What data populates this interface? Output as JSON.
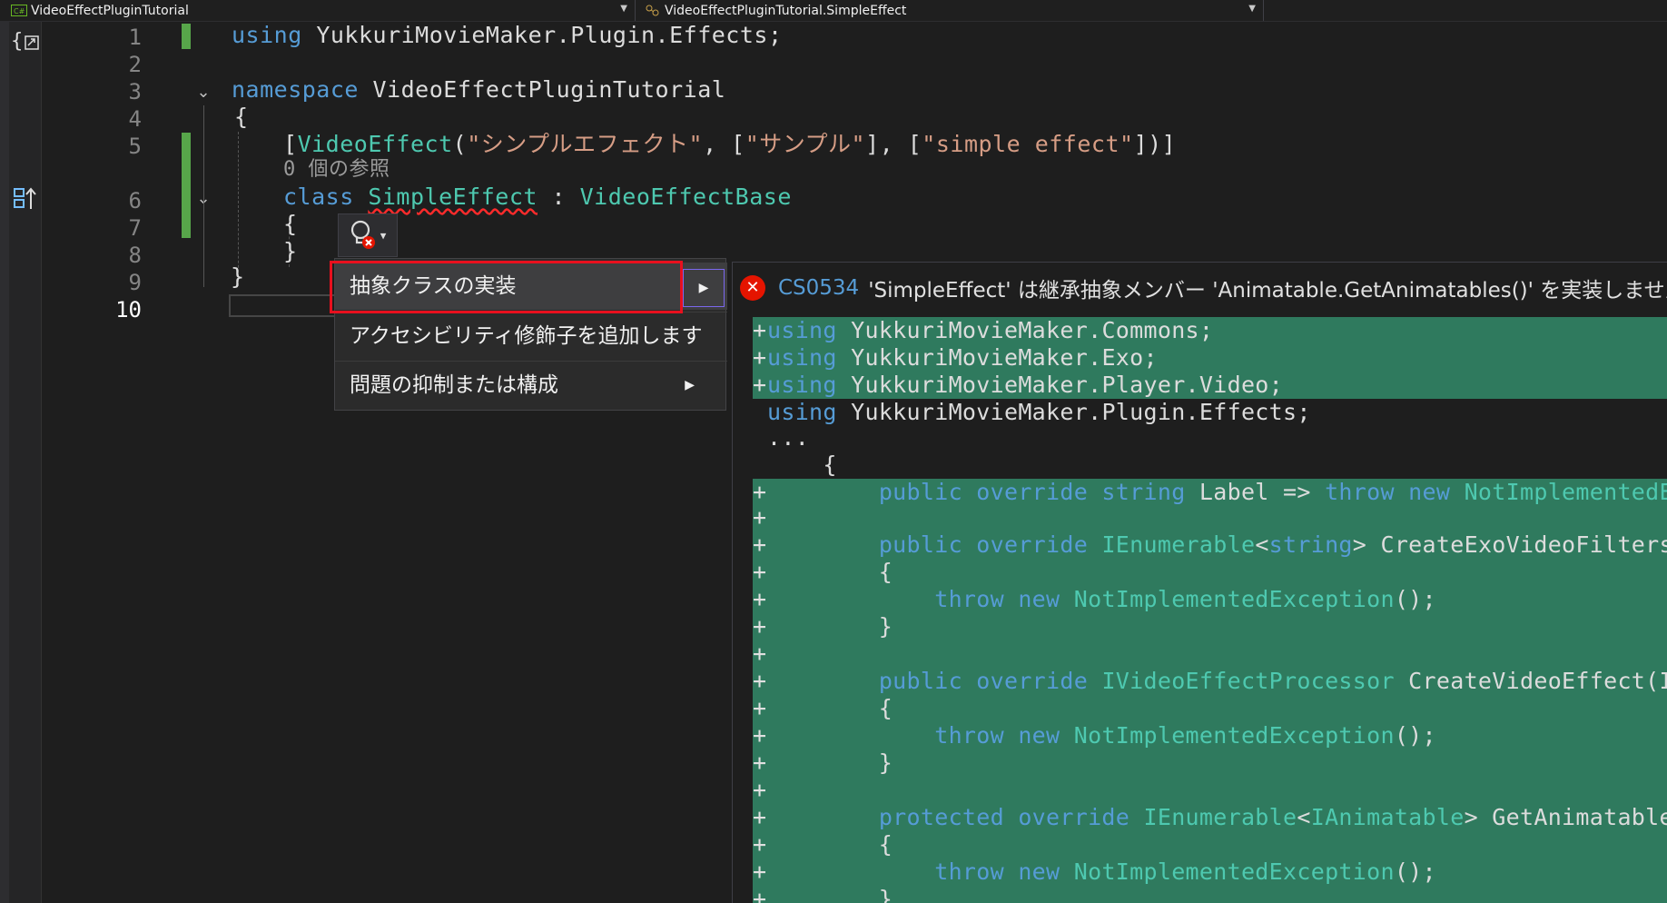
{
  "nav": {
    "project": "VideoEffectPluginTutorial",
    "member": "VideoEffectPluginTutorial.SimpleEffect"
  },
  "editor": {
    "line_numbers": [
      "1",
      "2",
      "3",
      "4",
      "5",
      "6",
      "7",
      "8",
      "9",
      "10"
    ],
    "line1": {
      "kw": "using",
      "rest": " YukkuriMovieMaker.Plugin.Effects;"
    },
    "line3": {
      "kw": "namespace",
      "rest": " VideoEffectPluginTutorial"
    },
    "line4": "{",
    "line5": {
      "open": "[",
      "attr": "VideoEffect",
      "p1": "(",
      "s1": "\"シンプルエフェクト\"",
      "p2": ", [",
      "s2": "\"サンプル\"",
      "p3": "], [",
      "s3": "\"simple effect\"",
      "p4": "])]"
    },
    "codelens": "0 個の参照",
    "line6": {
      "kw": "class",
      "name": "SimpleEffect",
      "colon": " : ",
      "base": "VideoEffectBase"
    },
    "line7": "{",
    "line8": "}",
    "line9": "}"
  },
  "quick_actions": {
    "items": [
      {
        "label": "抽象クラスの実装",
        "has_submenu": true
      },
      {
        "label": "アクセシビリティ修飾子を追加します",
        "has_submenu": false
      },
      {
        "label": "問題の抑制または構成",
        "has_submenu": true
      }
    ]
  },
  "preview": {
    "error_code": "CS0534",
    "error_message": "'SimpleEffect' は継承抽象メンバー 'Animatable.GetAnimatables()' を実装しません",
    "lines": [
      {
        "mark": "+",
        "added": true,
        "parts": [
          [
            "kw",
            "using"
          ],
          [
            "tx",
            " YukkuriMovieMaker.Commons;"
          ]
        ]
      },
      {
        "mark": "+",
        "added": true,
        "parts": [
          [
            "kw",
            "using"
          ],
          [
            "tx",
            " YukkuriMovieMaker.Exo;"
          ]
        ]
      },
      {
        "mark": "+",
        "added": true,
        "parts": [
          [
            "kw",
            "using"
          ],
          [
            "tx",
            " YukkuriMovieMaker.Player.Video;"
          ]
        ]
      },
      {
        "mark": " ",
        "added": false,
        "parts": [
          [
            "kw",
            "using"
          ],
          [
            "tx",
            " YukkuriMovieMaker.Plugin.Effects;"
          ]
        ]
      },
      {
        "mark": " ",
        "added": false,
        "parts": [
          [
            "tx",
            "..."
          ]
        ]
      },
      {
        "mark": " ",
        "added": false,
        "parts": [
          [
            "tx",
            "    {"
          ]
        ]
      },
      {
        "mark": "+",
        "added": true,
        "parts": [
          [
            "tx",
            "        "
          ],
          [
            "kw",
            "public override string"
          ],
          [
            "tx",
            " Label => "
          ],
          [
            "kw",
            "throw new"
          ],
          [
            "ty",
            " NotImplementedException();"
          ]
        ]
      },
      {
        "mark": "+",
        "added": true,
        "parts": []
      },
      {
        "mark": "+",
        "added": true,
        "parts": [
          [
            "tx",
            "        "
          ],
          [
            "kw",
            "public override"
          ],
          [
            "ty",
            " IEnumerable"
          ],
          [
            "tx",
            "<"
          ],
          [
            "kw",
            "string"
          ],
          [
            "tx",
            "> CreateExoVideoFilters("
          ]
        ]
      },
      {
        "mark": "+",
        "added": true,
        "parts": [
          [
            "tx",
            "        {"
          ]
        ]
      },
      {
        "mark": "+",
        "added": true,
        "parts": [
          [
            "tx",
            "            "
          ],
          [
            "kw",
            "throw new"
          ],
          [
            "ty",
            " NotImplementedException"
          ],
          [
            "tx",
            "();"
          ]
        ]
      },
      {
        "mark": "+",
        "added": true,
        "parts": [
          [
            "tx",
            "        }"
          ]
        ]
      },
      {
        "mark": "+",
        "added": true,
        "parts": []
      },
      {
        "mark": "+",
        "added": true,
        "parts": [
          [
            "tx",
            "        "
          ],
          [
            "kw",
            "public override"
          ],
          [
            "ty",
            " IVideoEffectProcessor"
          ],
          [
            "tx",
            " CreateVideoEffect(IGraphicsDevicesAndContext devices)"
          ]
        ]
      },
      {
        "mark": "+",
        "added": true,
        "parts": [
          [
            "tx",
            "        {"
          ]
        ]
      },
      {
        "mark": "+",
        "added": true,
        "parts": [
          [
            "tx",
            "            "
          ],
          [
            "kw",
            "throw new"
          ],
          [
            "ty",
            " NotImplementedException"
          ],
          [
            "tx",
            "();"
          ]
        ]
      },
      {
        "mark": "+",
        "added": true,
        "parts": [
          [
            "tx",
            "        }"
          ]
        ]
      },
      {
        "mark": "+",
        "added": true,
        "parts": []
      },
      {
        "mark": "+",
        "added": true,
        "parts": [
          [
            "tx",
            "        "
          ],
          [
            "kw",
            "protected override"
          ],
          [
            "ty",
            " IEnumerable"
          ],
          [
            "tx",
            "<"
          ],
          [
            "ty",
            "IAnimatable"
          ],
          [
            "tx",
            "> GetAnimatables()"
          ]
        ]
      },
      {
        "mark": "+",
        "added": true,
        "parts": [
          [
            "tx",
            "        {"
          ]
        ]
      },
      {
        "mark": "+",
        "added": true,
        "parts": [
          [
            "tx",
            "            "
          ],
          [
            "kw",
            "throw new"
          ],
          [
            "ty",
            " NotImplementedException"
          ],
          [
            "tx",
            "();"
          ]
        ]
      },
      {
        "mark": "+",
        "added": true,
        "parts": [
          [
            "tx",
            "        }"
          ]
        ]
      }
    ]
  },
  "colors": {
    "keyword": "#569cd6",
    "type": "#4ec9b0",
    "string": "#d69d85",
    "added_bg": "#2f7a5e",
    "highlight": "#e8101e",
    "error": "#e51400"
  }
}
